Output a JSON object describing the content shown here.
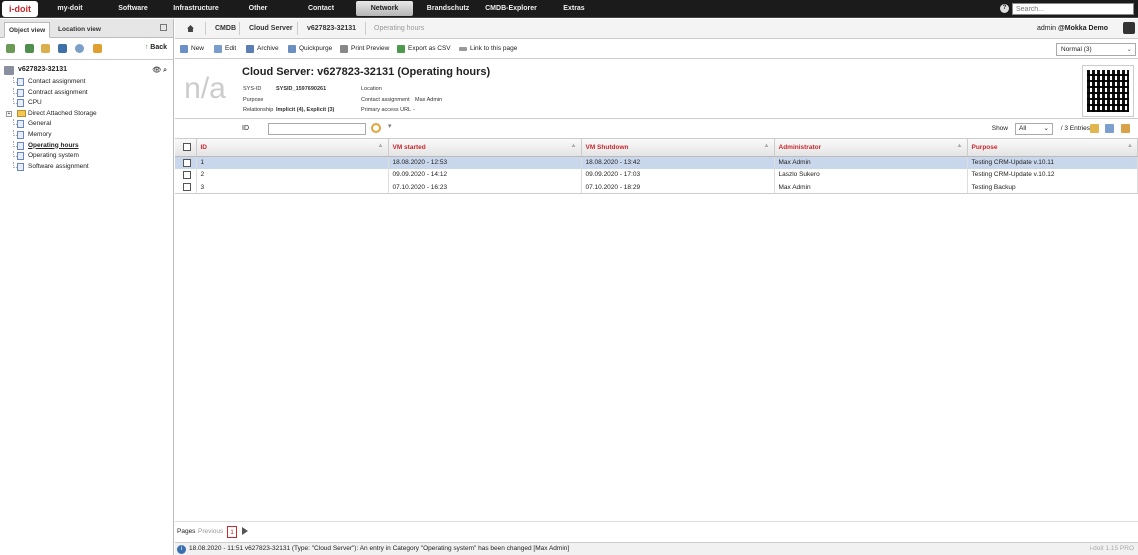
{
  "topbar": {
    "logo": "i-doit",
    "menu": [
      "my-doit",
      "Software",
      "Infrastructure",
      "Other",
      "Contact",
      "Network",
      "Brandschutz",
      "CMDB-Explorer",
      "Extras"
    ],
    "active_menu": "Network",
    "search_placeholder": "Search..."
  },
  "left": {
    "tabs": [
      "Object view",
      "Location view"
    ],
    "back_label": "Back",
    "tree_root": "v627823-32131",
    "tree_items": [
      "Contact assignment",
      "Contract assignment",
      "CPU",
      "Direct Attached Storage",
      "General",
      "Memory",
      "Operating hours",
      "Operating system",
      "Software assignment"
    ],
    "current_item": "Operating hours"
  },
  "breadcrumb": {
    "items": [
      "CMDB",
      "Cloud Server",
      "v627823-32131",
      "Operating hours"
    ]
  },
  "user": {
    "name": "admin",
    "tenant": "@Mokka Demo"
  },
  "actions": [
    "New",
    "Edit",
    "Archive",
    "Quickpurge",
    "Print Preview",
    "Export as CSV",
    "Link to this page"
  ],
  "view_select": "Normal (3)",
  "object": {
    "image_placeholder": "n/a",
    "title": "Cloud Server: v627823-32131 (Operating hours)",
    "sysid_label": "SYS-ID",
    "sysid_value": "SYSID_1597690261",
    "purpose_label": "Purpose",
    "relationship_label": "Relationship",
    "relationship_value": "Implicit (4), Explicit (3)",
    "location_label": "Location",
    "contact_label": "Contact assignment",
    "contact_value": "Max Admin",
    "access_label": "Primary access URL",
    "access_value": "-"
  },
  "filter": {
    "label": "ID",
    "show_label": "Show",
    "show_value": "All",
    "entries": "/ 3 Entries"
  },
  "table": {
    "columns": [
      "ID",
      "VM started",
      "VM Shutdown",
      "Administrator",
      "Purpose"
    ],
    "rows": [
      [
        "1",
        "18.08.2020 - 12:53",
        "18.08.2020 - 13:42",
        "Max Admin",
        "Testing CRM-Update v.10.11"
      ],
      [
        "2",
        "09.09.2020 - 14:12",
        "09.09.2020 - 17:03",
        "Laszlo Sukero",
        "Testing CRM-Update v.10.12"
      ],
      [
        "3",
        "07.10.2020 - 16:23",
        "07.10.2020 - 18:29",
        "Max Admin",
        "Testing Backup"
      ]
    ]
  },
  "pager": {
    "pages_label": "Pages",
    "previous_label": "Previous",
    "current_page": "1"
  },
  "status": {
    "message": "18.08.2020 - 11:51 v627823-32131 (Type: \"Cloud Server\"): An entry in Category \"Operating system\" has been changed [Max Admin]",
    "version": "i-doit 1.15 PRO"
  },
  "colors": {
    "accent": "#c8282e",
    "selected_row": "#c9d7ec",
    "topbar": "#1b1b1b"
  }
}
